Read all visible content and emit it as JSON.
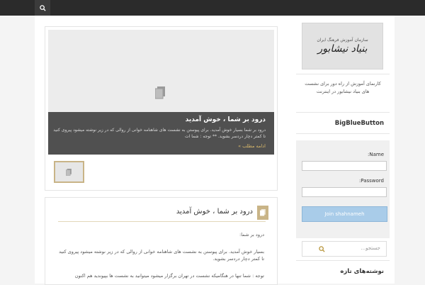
{
  "header": {
    "search_icon": "search-icon"
  },
  "sidebar": {
    "logo": {
      "small_text": "سازمان آموزش فرهنگ ایران",
      "main_text": "بنیاد نیشابور"
    },
    "description": "کارنمای آموزش از راه دور برای نشست های بنیاد نیشابور در اینترنت",
    "bbb_title": "BigBlueButton",
    "name_label": "Name:",
    "password_label": "Password:",
    "join_label": "Join shahnameh",
    "search_placeholder": "جستجو...",
    "recent_title": "نوشته‌های تازه"
  },
  "slider": {
    "title": "درود بر شما ، خوش آمدید",
    "text": "درود بر شما بسیار خوش آمدید. برای پیوستن به نشست های شاهنامه خوانی از روالی که در زیر نوشته میشود پیروی کنید تا کمتر دچار دردسر بشوید. ** توجه : شما ات",
    "read_more": "ادامه مطلب »"
  },
  "post": {
    "title": "درود بر شما ، خوش آمدید",
    "p1": "درود بر شما:",
    "p2": "بسیار خوش آمدید. برای پیوستن به نشست های شاهنامه خوانی از روالی که در زیر نوشته میشود پیروی کنید تا کمتر دچار دردسر بشوید.",
    "p3": "توجه : شما تنها در هنگامیکه نشست در تهران برگزار میشود میتوانید به نشست ها بپیوندید هم اکنون"
  }
}
